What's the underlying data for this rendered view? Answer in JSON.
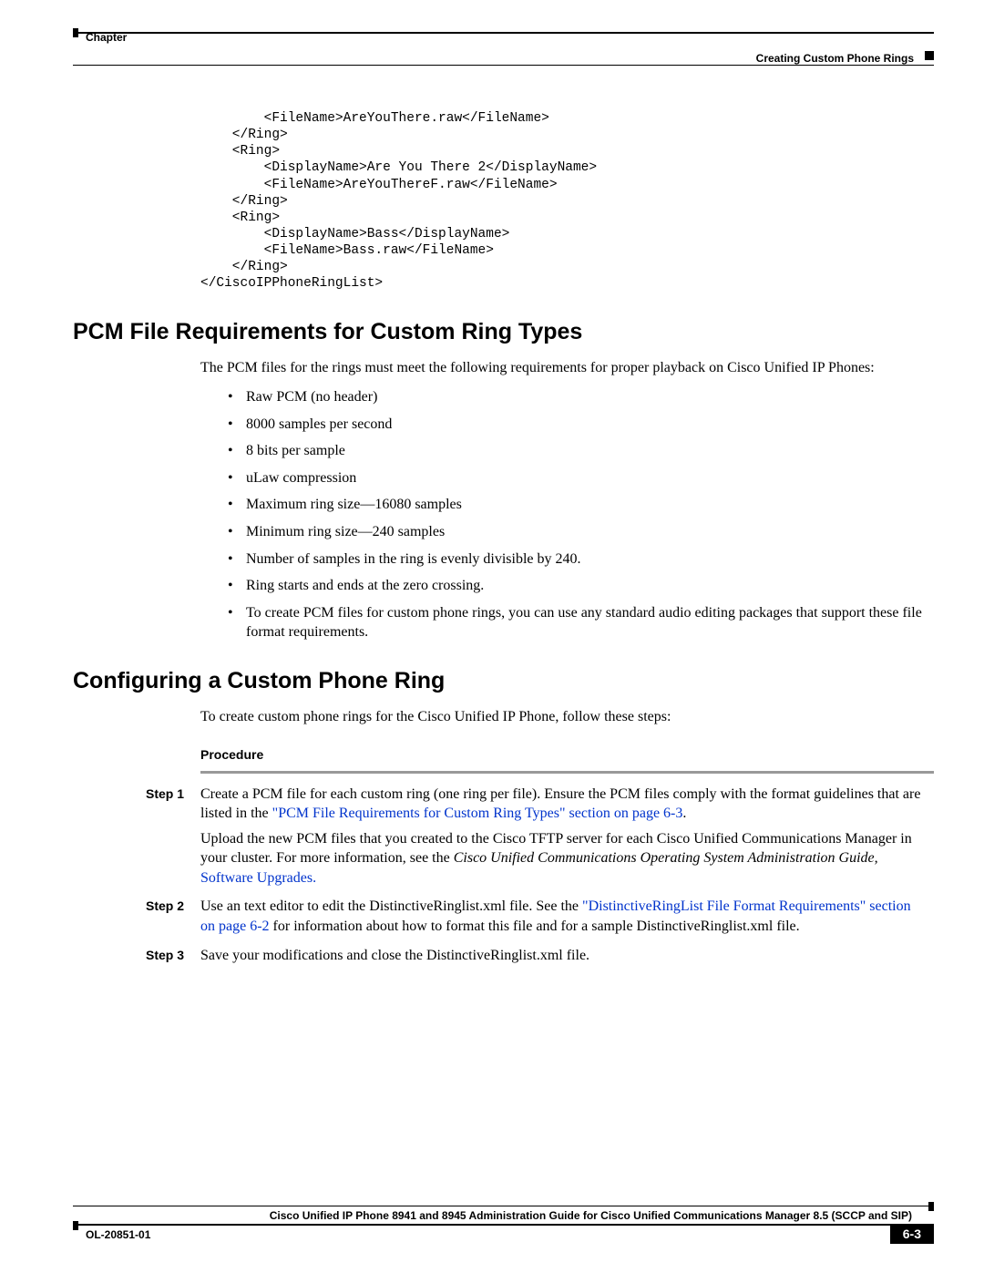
{
  "header": {
    "chapter_label": "Chapter",
    "subheader": "Creating Custom Phone Rings"
  },
  "code_block": "        <FileName>AreYouThere.raw</FileName>\n    </Ring>\n    <Ring>\n        <DisplayName>Are You There 2</DisplayName>\n        <FileName>AreYouThereF.raw</FileName>\n    </Ring>\n    <Ring>\n        <DisplayName>Bass</DisplayName>\n        <FileName>Bass.raw</FileName>\n    </Ring>\n</CiscoIPPhoneRingList>",
  "section1": {
    "heading": "PCM File Requirements for Custom Ring Types",
    "intro": "The PCM files for the rings must meet the following requirements for proper playback on Cisco Unified IP Phones:",
    "items": [
      "Raw PCM (no header)",
      "8000 samples per second",
      "8 bits per sample",
      "uLaw compression",
      "Maximum ring size—16080 samples",
      "Minimum ring size—240 samples",
      "Number of samples in the ring is evenly divisible by 240.",
      "Ring starts and ends at the zero crossing.",
      "To create PCM files for custom phone rings, you can use any standard audio editing packages that support these file format requirements."
    ]
  },
  "section2": {
    "heading": "Configuring a Custom Phone Ring",
    "intro": "To create custom phone rings for the Cisco Unified IP Phone, follow these steps:",
    "procedure_label": "Procedure",
    "steps": [
      {
        "label": "Step 1",
        "p1_a": "Create a PCM file for each custom ring (one ring per file). Ensure the PCM files comply with the format guidelines that are listed in the ",
        "p1_link": "\"PCM File Requirements for Custom Ring Types\" section on page 6-3",
        "p1_b": ".",
        "p2_a": "Upload the new PCM files that you created to the Cisco TFTP server for each Cisco Unified Communications Manager in your cluster. For more information, see the ",
        "p2_italic": "Cisco Unified Communications Operating System Administration Guide,",
        "p2_space": " ",
        "p2_link": "Software Upgrades."
      },
      {
        "label": "Step 2",
        "p1_a": "Use an text editor to edit the DistinctiveRinglist.xml file. See the ",
        "p1_link": "\"DistinctiveRingList File Format Requirements\" section on page 6-2",
        "p1_b": " for information about how to format this file and for a sample DistinctiveRinglist.xml file."
      },
      {
        "label": "Step 3",
        "p1_a": "Save your modifications and close the DistinctiveRinglist.xml file."
      }
    ]
  },
  "footer": {
    "guide": "Cisco Unified IP Phone 8941 and 8945 Administration Guide for Cisco Unified Communications Manager 8.5 (SCCP and SIP)",
    "ol": "OL-20851-01",
    "page_num": "6-3"
  }
}
